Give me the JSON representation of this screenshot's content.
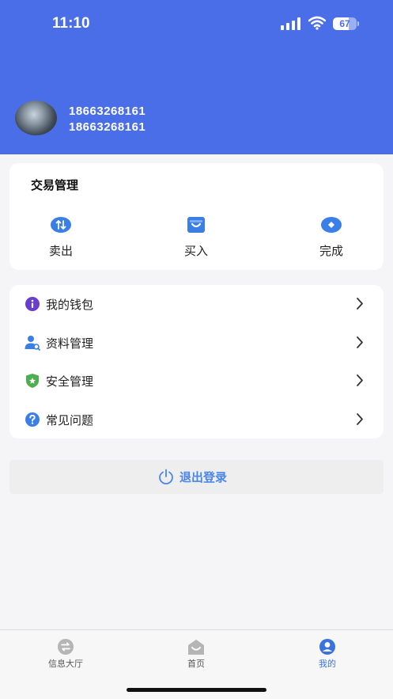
{
  "status_bar": {
    "time": "11:10",
    "battery_level": "67",
    "battery_fraction": 0.67
  },
  "profile": {
    "line1": "18663268161",
    "line2": "18663268161"
  },
  "trade": {
    "title": "交易管理",
    "items": [
      {
        "label": "卖出",
        "icon": "swap-arrows-icon"
      },
      {
        "label": "买入",
        "icon": "shopping-bag-icon"
      },
      {
        "label": "完成",
        "icon": "eye-icon"
      }
    ]
  },
  "menu": {
    "items": [
      {
        "label": "我的钱包",
        "icon": "info-icon"
      },
      {
        "label": "资料管理",
        "icon": "user-search-icon"
      },
      {
        "label": "安全管理",
        "icon": "shield-star-icon"
      },
      {
        "label": "常见问题",
        "icon": "help-icon"
      }
    ]
  },
  "logout": {
    "label": "退出登录",
    "icon": "power-icon"
  },
  "tabbar": {
    "tabs": [
      {
        "label": "信息大厅",
        "icon": "exchange-icon"
      },
      {
        "label": "首页",
        "icon": "home-icon"
      },
      {
        "label": "我的",
        "icon": "profile-icon",
        "active": true
      }
    ]
  },
  "colors": {
    "header": "#4a6ee8",
    "accent": "#4a86e8",
    "active_tab": "#3a72e0",
    "wallet_icon": "#6b3fc9",
    "security_icon": "#4caf50"
  }
}
